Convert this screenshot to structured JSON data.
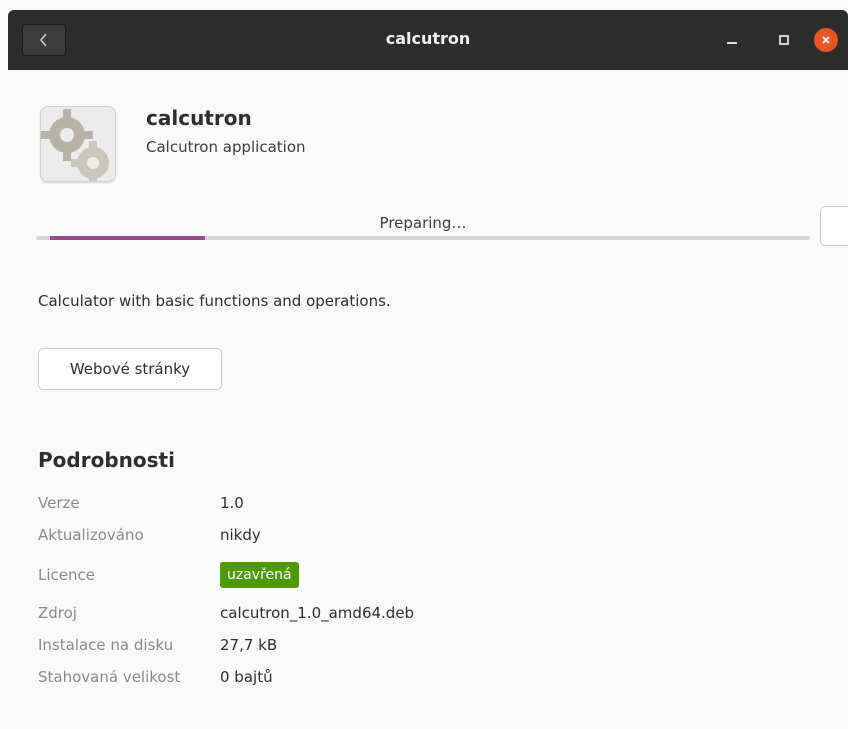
{
  "window": {
    "title": "calcutron"
  },
  "app": {
    "name": "calcutron",
    "summary": "Calcutron application",
    "description": "Calculator with basic functions and operations."
  },
  "progress": {
    "label": "Preparing…",
    "fraction": 0.2
  },
  "buttons": {
    "website": "Webové stránky"
  },
  "details": {
    "title": "Podrobnosti",
    "rows": [
      {
        "label": "Verze",
        "value": "1.0"
      },
      {
        "label": "Aktualizováno",
        "value": "nikdy"
      },
      {
        "label": "Licence",
        "value": "uzavřená"
      },
      {
        "label": "Zdroj",
        "value": "calcutron_1.0_amd64.deb"
      },
      {
        "label": "Instalace na disku",
        "value": "27,7 kB"
      },
      {
        "label": "Stahovaná velikost",
        "value": "0 bajtů"
      }
    ]
  },
  "colors": {
    "titlebar": "#2d2d2d",
    "close": "#e95420",
    "progress_fill": "#924d8b",
    "license_badge": "#4e9a06"
  }
}
